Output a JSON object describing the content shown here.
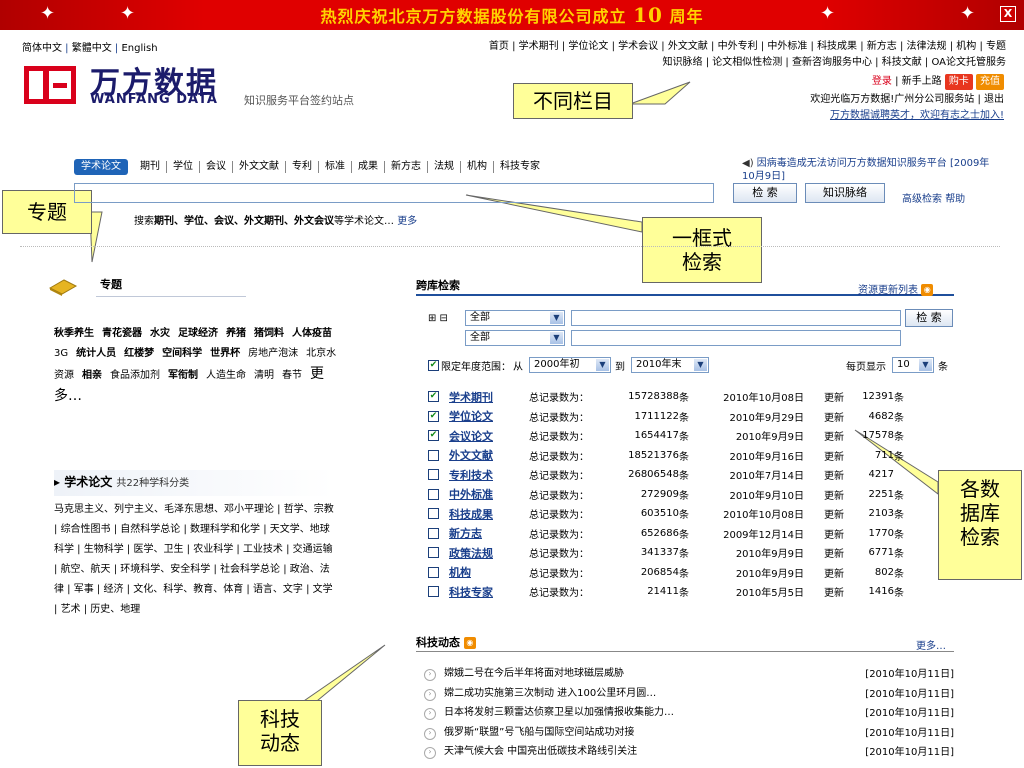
{
  "banner": {
    "text": "热烈庆祝北京万方数据股份有限公司成立",
    "number": "10",
    "suffix": "周年",
    "close": "X"
  },
  "langs": {
    "simplified": "简体中文",
    "traditional": "繁體中文",
    "english": "English"
  },
  "topnav": {
    "line1": [
      "首页",
      "学术期刊",
      "学位论文",
      "学术会议",
      "外文文献",
      "中外专利",
      "中外标准",
      "科技成果",
      "新方志",
      "法律法规",
      "机构",
      "专题"
    ],
    "line2": [
      "知识脉络",
      "论文相似性检测",
      "查新咨询服务中心",
      "科技文献",
      "OA论文托管服务"
    ]
  },
  "logo": {
    "cn": "万方数据",
    "en": "WANFANG DATA",
    "slogan": "知识服务平台签约站点"
  },
  "user": {
    "login": "登录",
    "register": "新手上路",
    "buy": "购卡",
    "recharge": "充值",
    "welcome": "欢迎光临万方数据!广州分公司服务站",
    "logout": "退出",
    "recruit": "万方数据诚聘英才，欢迎有志之士加入!"
  },
  "callouts": {
    "columns": "不同栏目",
    "topics": "专题",
    "onebox": "一框式检索",
    "dbsearch": "各数据库检索",
    "news": "科技动态"
  },
  "search": {
    "tabs": [
      "学术论文",
      "期刊",
      "学位",
      "会议",
      "外文文献",
      "专利",
      "标准",
      "成果",
      "新方志",
      "法规",
      "机构",
      "科技专家"
    ],
    "notice": "因病毒造成无法访问万方数据知识服务平台 [2009年10月9日]",
    "search_btn": "检 索",
    "knowledge_btn": "知识脉络",
    "advanced": "高级检索",
    "help": "帮助",
    "hint_pre": "搜索",
    "hint_bold": "期刊、学位、会议、外文期刊、外文会议",
    "hint_post": "等学术论文…",
    "hint_more": "更多"
  },
  "topics": {
    "title": "专题",
    "items": [
      {
        "t": "秋季养生",
        "b": true
      },
      {
        "t": "青花瓷器",
        "b": true
      },
      {
        "t": "水灾",
        "b": true
      },
      {
        "t": "足球经济",
        "b": true
      },
      {
        "t": "养猪",
        "b": true
      },
      {
        "t": "猪饲料",
        "b": true
      },
      {
        "t": "人体疫苗",
        "b": true
      },
      {
        "t": "3G",
        "b": false
      },
      {
        "t": "统计人员",
        "b": true
      },
      {
        "t": "红楼梦",
        "b": true
      },
      {
        "t": "空间科学",
        "b": true
      },
      {
        "t": "世界杯",
        "b": true
      },
      {
        "t": "房地产泡沫",
        "b": false
      },
      {
        "t": "北京水资源",
        "b": false
      },
      {
        "t": "相亲",
        "b": true
      },
      {
        "t": "食品添加剂",
        "b": false
      },
      {
        "t": "军衔制",
        "b": true
      },
      {
        "t": "人造生命",
        "b": false
      },
      {
        "t": "清明",
        "b": false
      },
      {
        "t": "春节",
        "b": false
      }
    ],
    "more": "更多…"
  },
  "disciplines": {
    "title": "学术论文",
    "count": "共22种学科分类",
    "items": [
      "马克思主义、列宁主义、毛泽东思想、邓小平理论",
      "哲学、宗教",
      "综合性图书",
      "自然科学总论",
      "数理科学和化学",
      "天文学、地球科学",
      "生物科学",
      "医学、卫生",
      "农业科学",
      "工业技术",
      "交通运输",
      "航空、航天",
      "环境科学、安全科学",
      "社会科学总论",
      "政治、法律",
      "军事",
      "经济",
      "文化、科学、教育、体育",
      "语言、文字",
      "文学",
      "艺术",
      "历史、地理"
    ]
  },
  "cross": {
    "title": "跨库检索",
    "update_list": "资源更新列表",
    "field1": "全部",
    "field2": "全部",
    "search_btn": "检 索",
    "year_label": "限定年度范围：",
    "from": "从",
    "from_val": "2000年初",
    "to": "到",
    "to_val": "2010年末",
    "per_page": "每页显示",
    "per_page_val": "10",
    "unit": "条",
    "expand": "⊞ ⊟"
  },
  "databases": [
    {
      "name": "学术期刊",
      "checked": true,
      "label": "总记录数为：",
      "count": "15728388",
      "unit": "条",
      "date": "2010年10月08日",
      "upd": "更新",
      "ucount": "12391",
      "uunit": "条"
    },
    {
      "name": "学位论文",
      "checked": true,
      "label": "总记录数为：",
      "count": "1711122",
      "unit": "条",
      "date": "2010年9月29日",
      "upd": "更新",
      "ucount": "4682",
      "uunit": "条"
    },
    {
      "name": "会议论文",
      "checked": true,
      "label": "总记录数为：",
      "count": "1654417",
      "unit": "条",
      "date": "2010年9月9日",
      "upd": "更新",
      "ucount": "17578",
      "uunit": "条"
    },
    {
      "name": "外文文献",
      "checked": false,
      "label": "总记录数为：",
      "count": "18521376",
      "unit": "条",
      "date": "2010年9月16日",
      "upd": "更新",
      "ucount": "711",
      "uunit": "条"
    },
    {
      "name": "专利技术",
      "checked": false,
      "label": "总记录数为：",
      "count": "26806548",
      "unit": "条",
      "date": "2010年7月14日",
      "upd": "更新",
      "ucount": "4217",
      "uunit": ""
    },
    {
      "name": "中外标准",
      "checked": false,
      "label": "总记录数为：",
      "count": "272909",
      "unit": "条",
      "date": "2010年9月10日",
      "upd": "更新",
      "ucount": "2251",
      "uunit": "条"
    },
    {
      "name": "科技成果",
      "checked": false,
      "label": "总记录数为：",
      "count": "603510",
      "unit": "条",
      "date": "2010年10月08日",
      "upd": "更新",
      "ucount": "2103",
      "uunit": "条"
    },
    {
      "name": "新方志",
      "checked": false,
      "label": "总记录数为：",
      "count": "652686",
      "unit": "条",
      "date": "2009年12月14日",
      "upd": "更新",
      "ucount": "1770",
      "uunit": "条"
    },
    {
      "name": "政策法规",
      "checked": false,
      "label": "总记录数为：",
      "count": "341337",
      "unit": "条",
      "date": "2010年9月9日",
      "upd": "更新",
      "ucount": "6771",
      "uunit": "条"
    },
    {
      "name": "机构",
      "checked": false,
      "label": "总记录数为：",
      "count": "206854",
      "unit": "条",
      "date": "2010年9月9日",
      "upd": "更新",
      "ucount": "802",
      "uunit": "条"
    },
    {
      "name": "科技专家",
      "checked": false,
      "label": "总记录数为：",
      "count": "21411",
      "unit": "条",
      "date": "2010年5月5日",
      "upd": "更新",
      "ucount": "1416",
      "uunit": "条"
    }
  ],
  "news": {
    "title": "科技动态",
    "more": "更多…",
    "items": [
      {
        "t": "嫦娥二号在今后半年将面对地球磁层威胁",
        "d": "[2010年10月11日]"
      },
      {
        "t": "嫦二成功实施第三次制动 进入100公里环月圆…",
        "d": "[2010年10月11日]"
      },
      {
        "t": "日本将发射三颗雷达侦察卫星以加强情报收集能力…",
        "d": "[2010年10月11日]"
      },
      {
        "t": "俄罗斯“联盟”号飞船与国际空间站成功对接",
        "d": "[2010年10月11日]"
      },
      {
        "t": "天津气候大会 中国亮出低碳技术路线引关注",
        "d": "[2010年10月11日]"
      }
    ]
  }
}
